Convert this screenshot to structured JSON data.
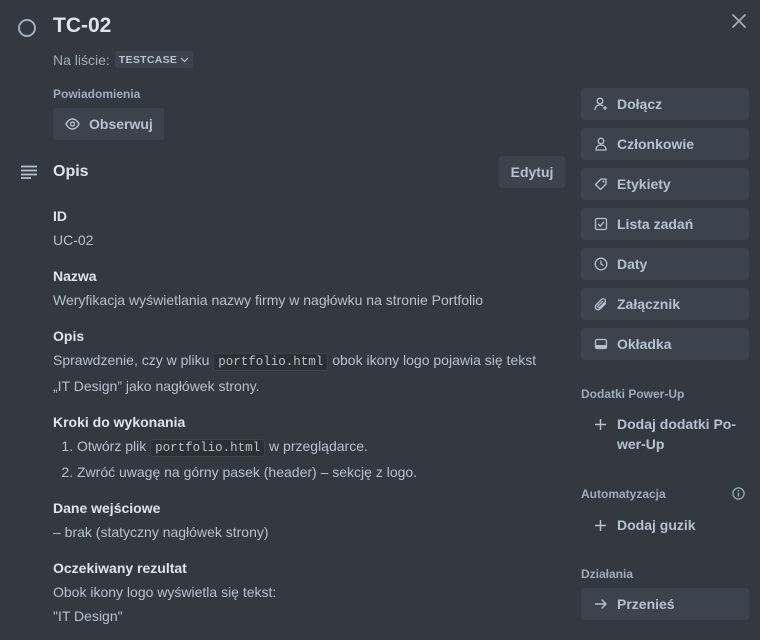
{
  "card": {
    "title": "TC-02",
    "list_prefix": "Na liście:",
    "list_name": "TESTCASE"
  },
  "notifications": {
    "heading": "Powiadomienia",
    "watch_label": "Obserwuj"
  },
  "description": {
    "heading": "Opis",
    "edit_label": "Edytuj",
    "id_heading": "ID",
    "id_value": "UC-02",
    "name_heading": "Nazwa",
    "name_value": "Weryfikacja wyświetlania nazwy firmy w nagłówku na stronie Portfolio",
    "desc_heading": "Opis",
    "desc_pre": "Sprawdzenie, czy w pliku",
    "desc_code": "portfolio.html",
    "desc_post": "obok ikony logo pojawia się tekst",
    "desc_line2": "„IT Design” jako nagłówek strony.",
    "steps_heading": "Kroki do wykonania",
    "step1_pre": "Otwórz plik",
    "step1_code": "portfolio.html",
    "step1_post": "w przeglądarce.",
    "step2": "Zwróć uwagę na górny pasek (header) – sekcję z logo.",
    "input_heading": "Dane wejściowe",
    "input_value": "– brak (statyczny nagłówek strony)",
    "expected_heading": "Oczekiwany rezultat",
    "expected_line1": "Obok ikony logo wyświetla się tekst:",
    "expected_line2": "\"IT Design\""
  },
  "sidebar": {
    "buttons": [
      {
        "label": "Dołącz",
        "icon": "user-plus-icon"
      },
      {
        "label": "Członkowie",
        "icon": "user-icon"
      },
      {
        "label": "Etykiety",
        "icon": "tag-icon"
      },
      {
        "label": "Lista zadań",
        "icon": "checkbox-icon"
      },
      {
        "label": "Daty",
        "icon": "clock-icon"
      },
      {
        "label": "Załącznik",
        "icon": "paperclip-icon"
      },
      {
        "label": "Okładka",
        "icon": "cover-icon"
      }
    ],
    "powerups_heading": "Dodatki Power-Up",
    "powerups_add_line1": "Dodaj dodatki Po-",
    "powerups_add_line2": "wer-Up",
    "automation_heading": "Automatyzacja",
    "automation_add": "Dodaj guzik",
    "actions_heading": "Działania",
    "move_label": "Przenieś"
  }
}
